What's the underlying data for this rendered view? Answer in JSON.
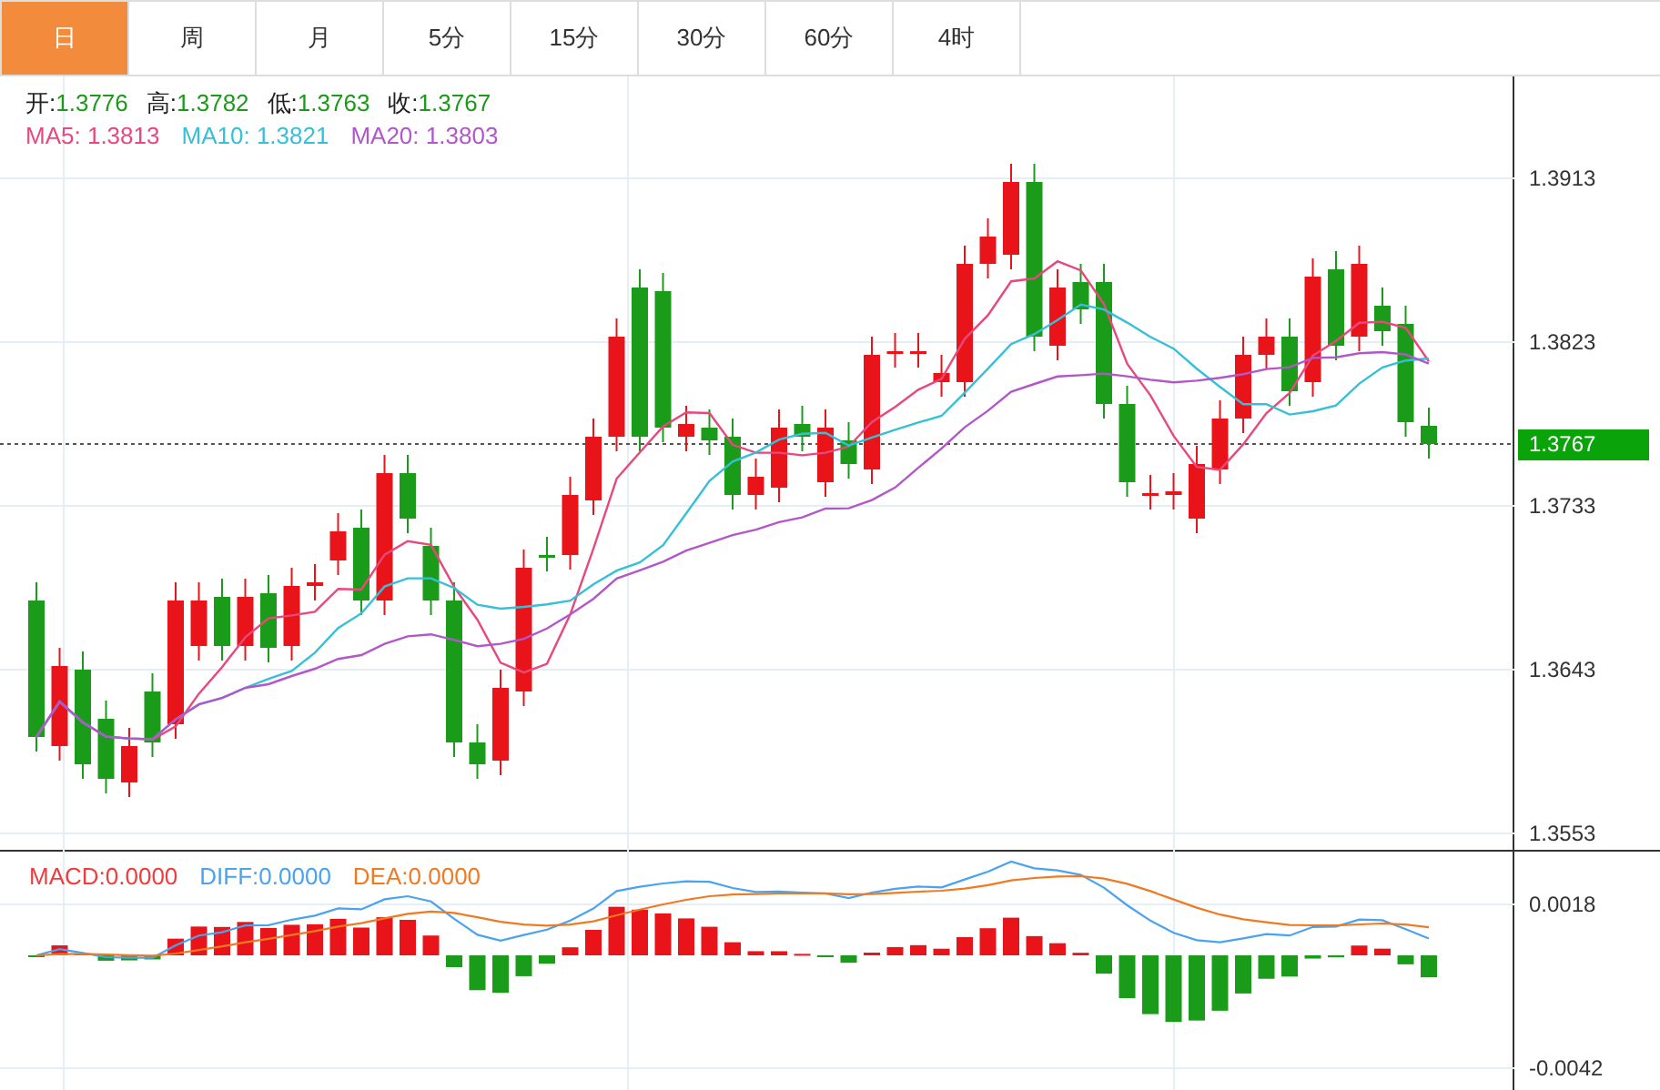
{
  "tabs": [
    {
      "label": "日",
      "selected": true
    },
    {
      "label": "周",
      "selected": false
    },
    {
      "label": "月",
      "selected": false
    },
    {
      "label": "5分",
      "selected": false
    },
    {
      "label": "15分",
      "selected": false
    },
    {
      "label": "30分",
      "selected": false
    },
    {
      "label": "60分",
      "selected": false
    },
    {
      "label": "4时",
      "selected": false
    }
  ],
  "ohlc": [
    {
      "label": "开:",
      "value": "1.3776"
    },
    {
      "label": "高:",
      "value": "1.3782"
    },
    {
      "label": "低:",
      "value": "1.3763"
    },
    {
      "label": "收:",
      "value": "1.3767"
    }
  ],
  "moving_averages": [
    {
      "label": "MA5:",
      "value": "1.3813",
      "color": "#e8487c"
    },
    {
      "label": "MA10:",
      "value": "1.3821",
      "color": "#36c0d8"
    },
    {
      "label": "MA20:",
      "value": "1.3803",
      "color": "#b257c9"
    }
  ],
  "price_axis": {
    "ticks": [
      "1.3913",
      "1.3823",
      "1.3733",
      "1.3643",
      "1.3553"
    ],
    "current_price": "1.3767"
  },
  "macd": {
    "legend": [
      {
        "label": "MACD:",
        "value": "0.0000",
        "color": "#f03c3c"
      },
      {
        "label": "DIFF:",
        "value": "0.0000",
        "color": "#4aa3f0"
      },
      {
        "label": "DEA:",
        "value": "0.0000",
        "color": "#f07a22"
      }
    ],
    "ticks": [
      "0.0018",
      "-0.0042"
    ]
  }
}
